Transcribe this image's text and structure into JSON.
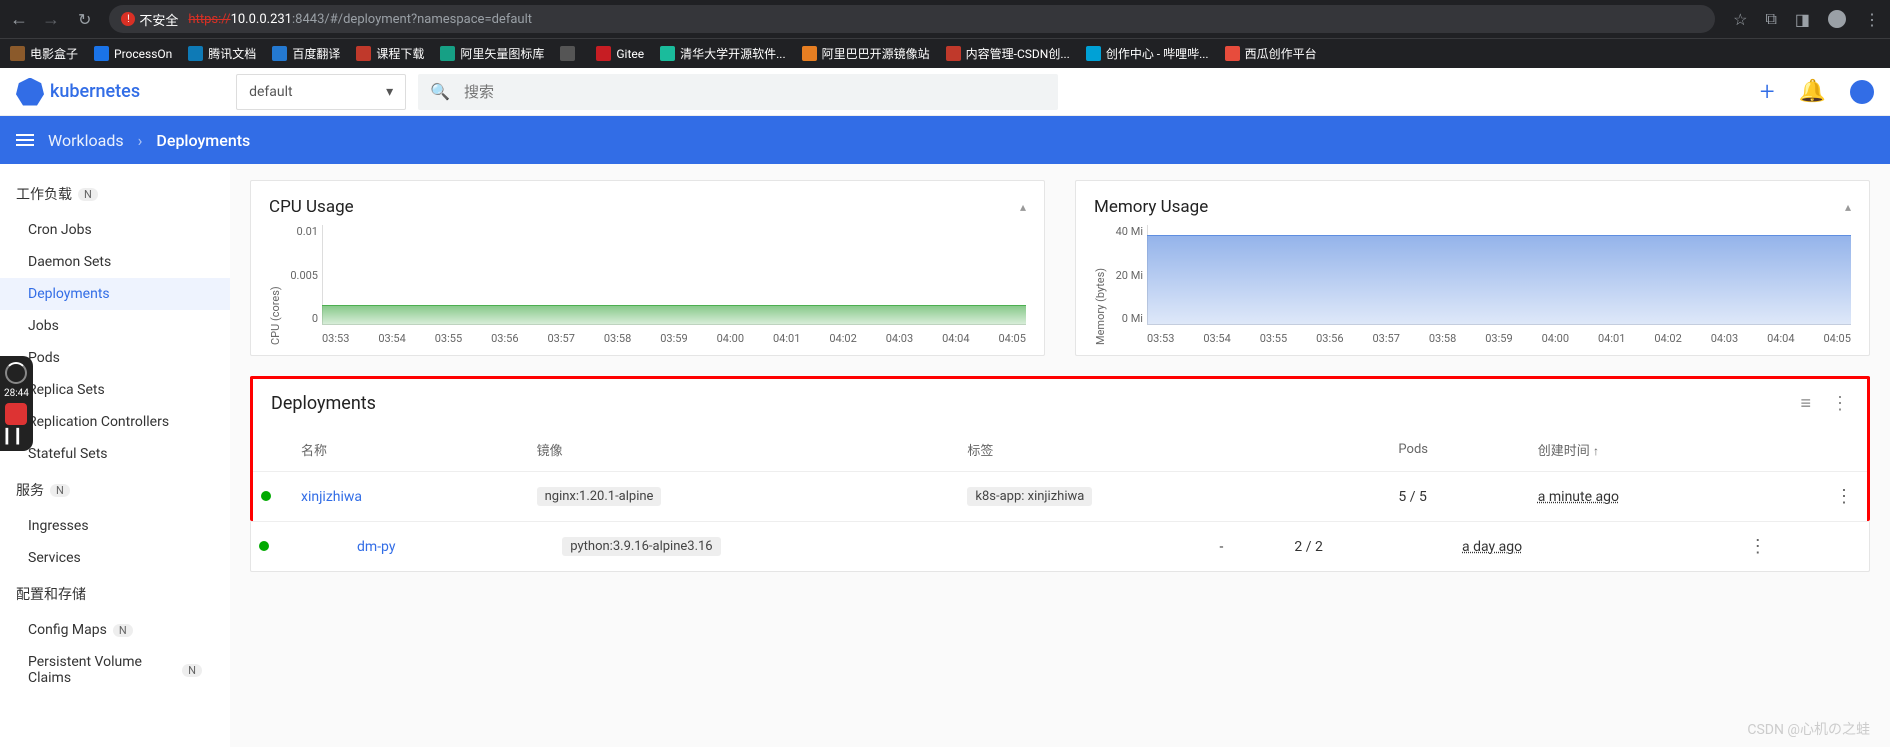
{
  "browser": {
    "insecure_label": "不安全",
    "url_scheme": "https://",
    "url_host": "10.0.0.231",
    "url_rest": ":8443/#/deployment?namespace=default"
  },
  "bookmarks": [
    {
      "label": "电影盒子",
      "color": "#8b5a2b"
    },
    {
      "label": "ProcessOn",
      "color": "#1a73e8"
    },
    {
      "label": "腾讯文档",
      "color": "#0e7ab6"
    },
    {
      "label": "百度翻译",
      "color": "#2479d1"
    },
    {
      "label": "课程下载",
      "color": "#c0392b"
    },
    {
      "label": "阿里矢量图标库",
      "color": "#16a085"
    },
    {
      "label": "",
      "color": "#555"
    },
    {
      "label": "Gitee",
      "color": "#c71d23"
    },
    {
      "label": "清华大学开源软件...",
      "color": "#1abc9c"
    },
    {
      "label": "阿里巴巴开源镜像站",
      "color": "#e67e22"
    },
    {
      "label": "内容管理-CSDN创...",
      "color": "#c0392b"
    },
    {
      "label": "创作中心 - 哔哩哔...",
      "color": "#00a1d6"
    },
    {
      "label": "西瓜创作平台",
      "color": "#e74c3c"
    }
  ],
  "k8s": {
    "logo_text": "kubernetes",
    "namespace": "default",
    "search_placeholder": "搜索"
  },
  "breadcrumb": {
    "root": "Workloads",
    "current": "Deployments"
  },
  "sidebar": {
    "section1": "工作负载",
    "items1": [
      "Cron Jobs",
      "Daemon Sets",
      "Deployments",
      "Jobs",
      "Pods",
      "Replica Sets",
      "Replication Controllers",
      "Stateful Sets"
    ],
    "section2": "服务",
    "items2": [
      "Ingresses",
      "Services"
    ],
    "section3": "配置和存储",
    "items3": [
      "Config Maps",
      "Persistent Volume Claims"
    ]
  },
  "charts": {
    "cpu": {
      "title": "CPU Usage",
      "ylabel": "CPU (cores)"
    },
    "mem": {
      "title": "Memory Usage",
      "ylabel": "Memory (bytes)"
    }
  },
  "chart_data": [
    {
      "type": "area",
      "title": "CPU Usage",
      "ylabel": "CPU (cores)",
      "ylim": [
        0,
        0.01
      ],
      "yticks": [
        "0.01",
        "0.005",
        "0"
      ],
      "x": [
        "03:53",
        "03:54",
        "03:55",
        "03:56",
        "03:57",
        "03:58",
        "03:59",
        "04:00",
        "04:01",
        "04:02",
        "04:03",
        "04:04",
        "04:05"
      ],
      "series": [
        {
          "name": "cpu",
          "values": [
            0.002,
            0.002,
            0.002,
            0.002,
            0.002,
            0.002,
            0.002,
            0.002,
            0.002,
            0.002,
            0.002,
            0.002,
            0.002
          ],
          "color": "#4caf50"
        }
      ]
    },
    {
      "type": "area",
      "title": "Memory Usage",
      "ylabel": "Memory (bytes)",
      "ylim": [
        0,
        40
      ],
      "yunit": "Mi",
      "yticks": [
        "40 Mi",
        "20 Mi",
        "0 Mi"
      ],
      "x": [
        "03:53",
        "03:54",
        "03:55",
        "03:56",
        "03:57",
        "03:58",
        "03:59",
        "04:00",
        "04:01",
        "04:02",
        "04:03",
        "04:04",
        "04:05"
      ],
      "series": [
        {
          "name": "mem",
          "values": [
            36,
            36,
            36,
            36,
            36,
            36,
            36,
            36,
            36,
            36,
            36,
            36,
            36
          ],
          "color": "#5f8ee0"
        }
      ]
    }
  ],
  "table": {
    "title": "Deployments",
    "headers": {
      "name": "名称",
      "image": "镜像",
      "labels": "标签",
      "pods": "Pods",
      "created": "创建时间"
    },
    "rows": [
      {
        "name": "xinjizhiwa",
        "image": "nginx:1.20.1-alpine",
        "labels": "k8s-app: xinjizhiwa",
        "pods": "5 / 5",
        "created": "a minute ago"
      },
      {
        "name": "dm-py",
        "image": "python:3.9.16-alpine3.16",
        "labels": "-",
        "pods": "2 / 2",
        "created": "a day ago"
      }
    ]
  },
  "recorder": {
    "time": "28:44"
  },
  "watermark": "CSDN @心机の之蛙"
}
